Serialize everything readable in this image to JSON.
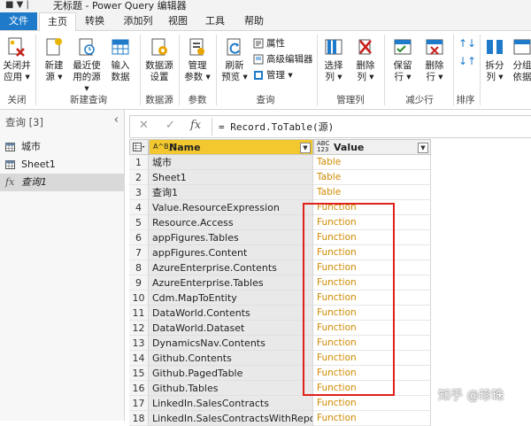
{
  "titlebar": {
    "quick_access": "■ ▼ |",
    "title": "无标题 - Power Query 编辑器"
  },
  "tabs": [
    "文件",
    "主页",
    "转换",
    "添加列",
    "视图",
    "工具",
    "帮助"
  ],
  "ribbon": {
    "buttons": {
      "close_apply": "关闭并\n应用 ▾",
      "new_source": "新建\n源 ▾",
      "recent_sources": "最近使\n用的源 ▾",
      "enter_data": "输入\n数据",
      "data_source_settings": "数据源\n设置",
      "manage_params": "管理\n参数 ▾",
      "refresh_preview": "刷新\n预览 ▾",
      "properties": "属性",
      "advanced_editor": "高级编辑器",
      "manage": "管理 ▾",
      "choose_columns": "选择\n列 ▾",
      "remove_columns": "删除\n列 ▾",
      "keep_rows": "保留\n行 ▾",
      "remove_rows": "删除\n行 ▾",
      "split_column": "拆分\n列 ▾",
      "group_by": "分组\n依据"
    },
    "groups": {
      "close": "关闭",
      "new_query": "新建查询",
      "data_sources": "数据源",
      "params": "参数",
      "query": "查询",
      "manage_columns": "管理列",
      "reduce_rows": "减少行",
      "sort": "排序"
    }
  },
  "left_pane": {
    "header": "查询 [3]",
    "collapse": "‹",
    "items": [
      {
        "label": "城市",
        "icon": "table-icon"
      },
      {
        "label": "Sheet1",
        "icon": "table-icon"
      },
      {
        "label": "查询1",
        "icon": "function-icon"
      }
    ]
  },
  "formula_bar": {
    "cancel": "✕",
    "confirm": "✓",
    "fx": "fx",
    "text": "= Record.ToTable(源)"
  },
  "grid": {
    "headers": {
      "name": "Name",
      "value": "Value",
      "name_type": "A^B_C",
      "value_type": "ABC 123"
    },
    "rows": [
      {
        "n": "1",
        "name": "城市",
        "value": "Table"
      },
      {
        "n": "2",
        "name": "Sheet1",
        "value": "Table"
      },
      {
        "n": "3",
        "name": "查询1",
        "value": "Table"
      },
      {
        "n": "4",
        "name": "Value.ResourceExpression",
        "value": "Function"
      },
      {
        "n": "5",
        "name": "Resource.Access",
        "value": "Function"
      },
      {
        "n": "6",
        "name": "appFigures.Tables",
        "value": "Function"
      },
      {
        "n": "7",
        "name": "appFigures.Content",
        "value": "Function"
      },
      {
        "n": "8",
        "name": "AzureEnterprise.Contents",
        "value": "Function"
      },
      {
        "n": "9",
        "name": "AzureEnterprise.Tables",
        "value": "Function"
      },
      {
        "n": "10",
        "name": "Cdm.MapToEntity",
        "value": "Function"
      },
      {
        "n": "11",
        "name": "DataWorld.Contents",
        "value": "Function"
      },
      {
        "n": "12",
        "name": "DataWorld.Dataset",
        "value": "Function"
      },
      {
        "n": "13",
        "name": "DynamicsNav.Contents",
        "value": "Function"
      },
      {
        "n": "14",
        "name": "Github.Contents",
        "value": "Function"
      },
      {
        "n": "15",
        "name": "Github.PagedTable",
        "value": "Function"
      },
      {
        "n": "16",
        "name": "Github.Tables",
        "value": "Function"
      },
      {
        "n": "17",
        "name": "LinkedIn.SalesContracts",
        "value": "Function"
      },
      {
        "n": "18",
        "name": "LinkedIn.SalesContractsWithReport",
        "value": "Function"
      }
    ]
  },
  "watermark": "知乎 @珍珠",
  "colors": {
    "accent": "#1f7bc9",
    "header_yellow": "#f2c82e",
    "value_text": "#d08a00",
    "highlight_box": "#e0201b"
  }
}
